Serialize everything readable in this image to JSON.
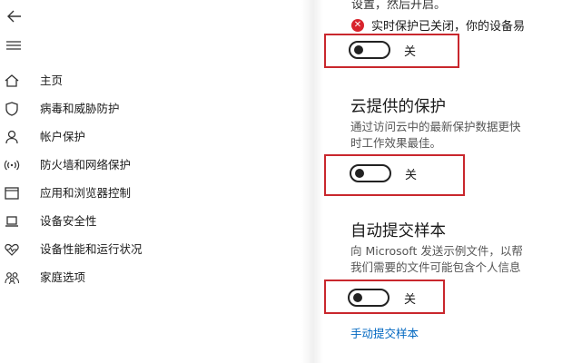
{
  "sidebar": {
    "items": [
      {
        "label": "主页",
        "icon": "home-icon"
      },
      {
        "label": "病毒和威胁防护",
        "icon": "shield-icon"
      },
      {
        "label": "帐户保护",
        "icon": "person-icon"
      },
      {
        "label": "防火墙和网络保护",
        "icon": "wifi-signal-icon"
      },
      {
        "label": "应用和浏览器控制",
        "icon": "browser-window-icon"
      },
      {
        "label": "设备安全性",
        "icon": "laptop-icon"
      },
      {
        "label": "设备性能和运行状况",
        "icon": "heart-pulse-icon"
      },
      {
        "label": "家庭选项",
        "icon": "family-icon"
      }
    ]
  },
  "main": {
    "clipped_text": "设置，然后开启。",
    "realtime_status": "实时保护已关闭，你的设备易",
    "toggle_realtime_label": "关",
    "cloud": {
      "title": "云提供的保护",
      "desc_line1": "通过访问云中的最新保护数据更快",
      "desc_line2": "时工作效果最佳。",
      "toggle_label": "关"
    },
    "sample": {
      "title": "自动提交样本",
      "desc_line1": "向 Microsoft 发送示例文件，以帮",
      "desc_line2": "我们需要的文件可能包含个人信息",
      "toggle_label": "关"
    },
    "manual_submit_link": "手动提交样本"
  },
  "colors": {
    "accent_link": "#0067c0",
    "highlight_border": "#c9272d",
    "error_red": "#d8242d"
  }
}
